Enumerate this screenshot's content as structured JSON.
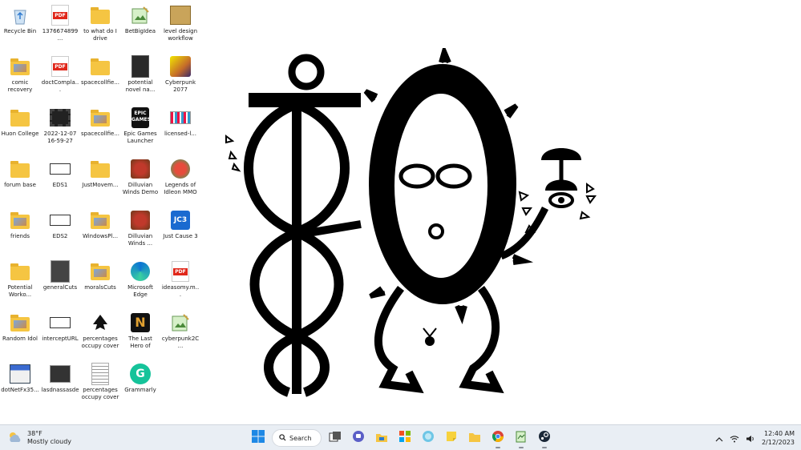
{
  "desktop_icons": [
    {
      "label": "Recycle Bin",
      "icon": "recycle-bin-icon"
    },
    {
      "label": "1376674899 ...",
      "icon": "pdf-icon"
    },
    {
      "label": "to what do I drive",
      "icon": "folder-icon"
    },
    {
      "label": "BetBigIdea",
      "icon": "notepad-image-icon"
    },
    {
      "label": "level design workflow",
      "icon": "image-file-icon"
    },
    {
      "label": "comic recovery",
      "icon": "folder-icon"
    },
    {
      "label": "doctCompla...",
      "icon": "pdf-icon"
    },
    {
      "label": "spacecollfie...",
      "icon": "folder-icon"
    },
    {
      "label": "potential novel na...",
      "icon": "image-file-icon"
    },
    {
      "label": "Cyberpunk 2077",
      "icon": "cyberpunk-icon"
    },
    {
      "label": "Huon College",
      "icon": "folder-icon"
    },
    {
      "label": "2022-12-07 16-59-27",
      "icon": "video-file-icon"
    },
    {
      "label": "spacecollfie...",
      "icon": "folder-icon"
    },
    {
      "label": "Epic Games Launcher",
      "icon": "epic-games-icon"
    },
    {
      "label": "licensed-l...",
      "icon": "image-file-icon"
    },
    {
      "label": "forum base",
      "icon": "folder-icon"
    },
    {
      "label": "EDS1",
      "icon": "image-file-icon"
    },
    {
      "label": "JustMovem...",
      "icon": "folder-icon"
    },
    {
      "label": "Dilluvian Winds Demo",
      "icon": "game-icon"
    },
    {
      "label": "Legends of Idleon MMO",
      "icon": "game-icon"
    },
    {
      "label": "friends",
      "icon": "folder-icon"
    },
    {
      "label": "EDS2",
      "icon": "image-file-icon"
    },
    {
      "label": "WindowsPl...",
      "icon": "folder-icon"
    },
    {
      "label": "Dilluvian Winds ...",
      "icon": "game-icon"
    },
    {
      "label": "Just Cause 3",
      "icon": "jc3-icon"
    },
    {
      "label": "Potential Worko...",
      "icon": "folder-icon"
    },
    {
      "label": "generalCuts",
      "icon": "image-file-icon"
    },
    {
      "label": "moralsCuts",
      "icon": "folder-icon"
    },
    {
      "label": "Microsoft Edge",
      "icon": "edge-icon"
    },
    {
      "label": "ideasomy.m...",
      "icon": "pdf-icon"
    },
    {
      "label": "Random Idol",
      "icon": "folder-icon"
    },
    {
      "label": "interceptURL",
      "icon": "image-file-icon"
    },
    {
      "label": "percentages occupy cover",
      "icon": "inkscape-icon"
    },
    {
      "label": "The Last Hero of Nostalgai...",
      "icon": "game-icon"
    },
    {
      "label": "cyberpunk2C...",
      "icon": "notepad-image-icon"
    },
    {
      "label": "dotNetFx35...",
      "icon": "installer-icon"
    },
    {
      "label": "lasdnassasde",
      "icon": "image-file-icon"
    },
    {
      "label": "percentages occupy cover",
      "icon": "document-icon"
    },
    {
      "label": "Grammarly",
      "icon": "grammarly-icon"
    }
  ],
  "taskbar": {
    "weather": {
      "temp": "38°F",
      "condition": "Mostly cloudy",
      "icon": "weather-cloud-icon"
    },
    "search_label": "Search",
    "apps": [
      "task-view-icon",
      "teams-chat-icon",
      "file-explorer-icon",
      "store-icon",
      "sticky-notes-icon",
      "folder-icon",
      "chrome-icon",
      "notepad-icon",
      "steam-icon"
    ],
    "clock": {
      "time": "12:40 AM",
      "date": "2/12/2023"
    }
  },
  "colors": {
    "taskbar_bg": "#e9eef4",
    "folder": "#f5c542",
    "pdf_red": "#e0271a"
  }
}
